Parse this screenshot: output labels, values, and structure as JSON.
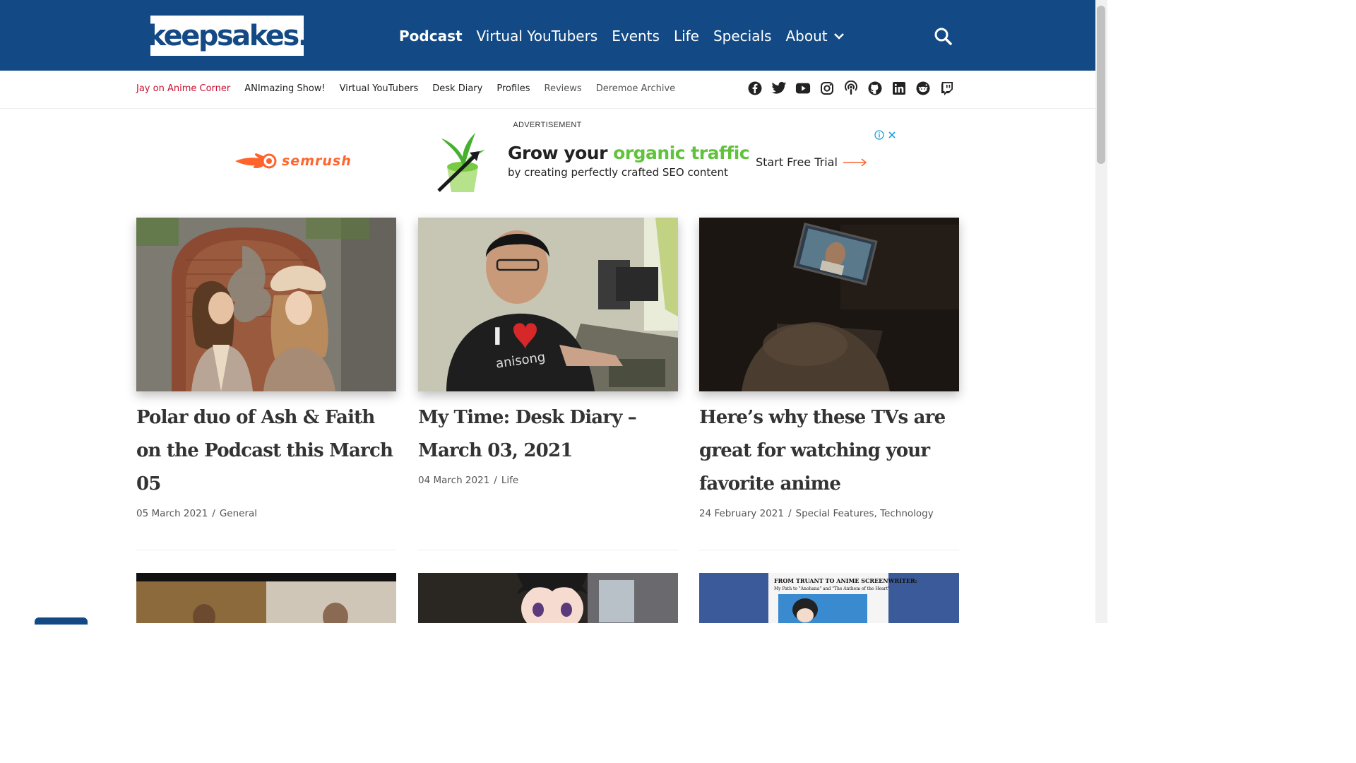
{
  "header": {
    "logo_text": "keepsakes.",
    "nav": [
      {
        "label": "Podcast",
        "active": true
      },
      {
        "label": "Virtual YouTubers"
      },
      {
        "label": "Events"
      },
      {
        "label": "Life"
      },
      {
        "label": "Specials"
      },
      {
        "label": "About"
      }
    ],
    "search_icon": "search-icon",
    "brand_color": "#134a85"
  },
  "subnav": {
    "items": [
      "Jay on Anime Corner",
      "ANImazing Show!",
      "Virtual YouTubers",
      "Desk Diary",
      "Profiles",
      "Reviews",
      "Deremoe Archive"
    ],
    "social_icons": [
      "facebook-icon",
      "twitter-icon",
      "youtube-icon",
      "instagram-icon",
      "podcast-icon",
      "github-icon",
      "linkedin-icon",
      "reddit-icon",
      "twitch-icon"
    ]
  },
  "ad": {
    "label": "ADVERTISEMENT",
    "brand": "semrush",
    "headline_part1": "Grow your ",
    "headline_part2": "organic traffic",
    "subline": "by creating perfectly crafted SEO content",
    "cta": "Start Free Trial"
  },
  "posts": [
    {
      "title": "Polar duo of Ash & Faith on the Podcast this March 05",
      "date": "05 March 2021",
      "category": "General"
    },
    {
      "title": "My Time: Desk Diary – March 03, 2021",
      "date": "04 March 2021",
      "category": "Life"
    },
    {
      "title": "Here’s why these TVs are great for watching your favorite anime",
      "date": "24 February 2021",
      "category": "Special Features, Technology"
    }
  ],
  "next_row": {
    "third_thumb_text": "FROM TRUANT TO ANIME SCREENWRITER:",
    "third_thumb_subtext": "My Path to \"Anohana\" and \"The Anthem of the Heart\""
  }
}
